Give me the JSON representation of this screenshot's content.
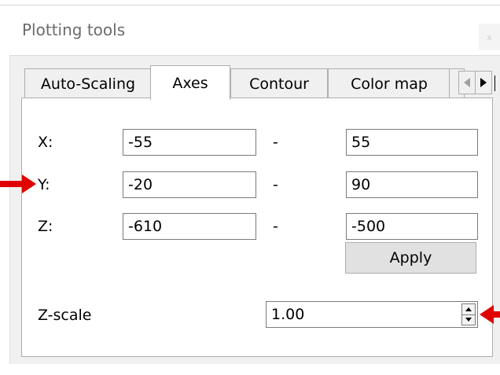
{
  "window": {
    "title": "Plotting tools",
    "close_glyph": "x"
  },
  "tabs": [
    {
      "label": "Auto-Scaling",
      "active": false
    },
    {
      "label": "Axes",
      "active": true
    },
    {
      "label": "Contour",
      "active": false
    },
    {
      "label": "Color map",
      "active": false
    }
  ],
  "tab_scroll": {
    "left_icon": "triangle-left-icon",
    "right_icon": "triangle-right-icon"
  },
  "axes": {
    "range_separator": "-",
    "rows": [
      {
        "label": "X:",
        "min": "-55",
        "max": "55"
      },
      {
        "label": "Y:",
        "min": "-20",
        "max": "90"
      },
      {
        "label": "Z:",
        "min": "-610",
        "max": "-500"
      }
    ],
    "apply_label": "Apply",
    "zscale_label": "Z-scale",
    "zscale_value": "1.00"
  },
  "annotations": {
    "arrow_color": "#e00000",
    "icon": "red-arrow-icon"
  },
  "colors": {
    "panel_bg": "#ffffff",
    "window_bg": "#f0f0f0",
    "border": "#adadad"
  }
}
